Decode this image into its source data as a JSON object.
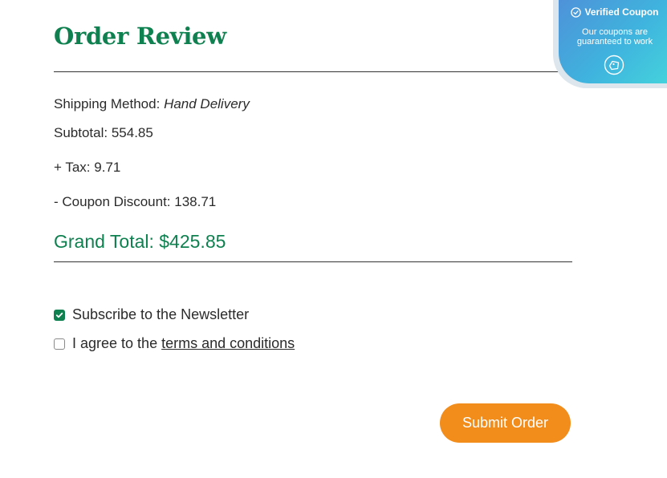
{
  "title": "Order Review",
  "shipping": {
    "label": "Shipping Method:",
    "value": "Hand Delivery"
  },
  "subtotal": {
    "label": "Subtotal:",
    "value": "554.85"
  },
  "tax": {
    "label": "+ Tax:",
    "value": "9.71"
  },
  "coupon": {
    "label": "- Coupon Discount:",
    "value": "138.71"
  },
  "grand_total": {
    "label": "Grand Total:",
    "value": "$425.85"
  },
  "newsletter": {
    "label": "Subscribe to the Newsletter",
    "checked": true
  },
  "terms": {
    "prefix": "I agree to the",
    "link": "terms and conditions",
    "checked": false
  },
  "submit_label": "Submit Order",
  "badge": {
    "title": "Verified Coupon",
    "line1": "Our coupons are",
    "line2": "guaranteed to work",
    "check_icon": "check-circle-icon",
    "brand_icon": "coupon-logo-icon"
  },
  "colors": {
    "accent_green": "#0f8150",
    "button_orange": "#f28c1a",
    "badge_blue": "#3fb4de"
  }
}
